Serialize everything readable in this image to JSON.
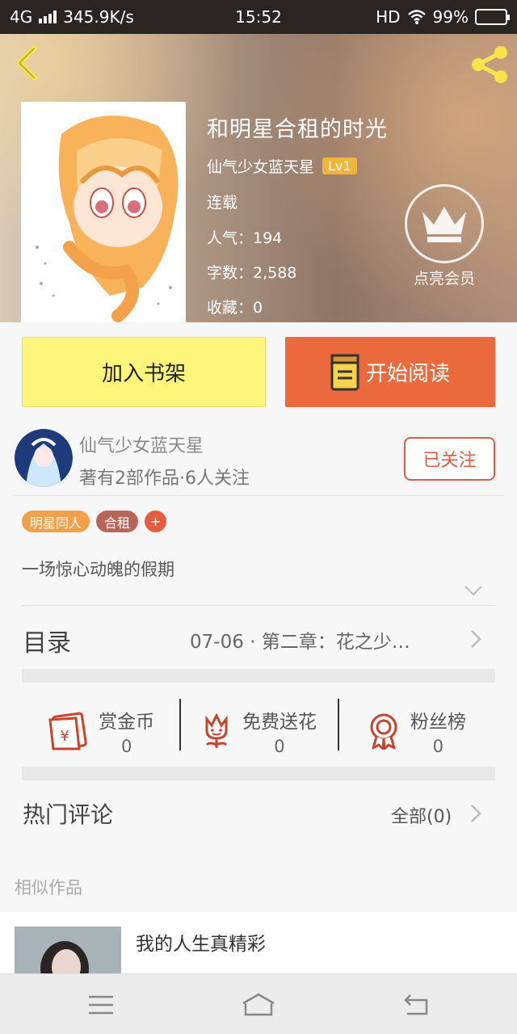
{
  "status_bar": {
    "network": "4G",
    "speed": "345.9K/s",
    "time": "15:52",
    "hd": "HD",
    "battery": "99%"
  },
  "book": {
    "title": "和明星合租的时光",
    "author": "仙气少女蓝天星",
    "level": "Lv1",
    "status": "连载",
    "popularity": "人气：194",
    "word_count": "字数：2,588",
    "favorites": "收藏：0"
  },
  "vip": {
    "label": "点亮会员"
  },
  "actions": {
    "add_shelf": "加入书架",
    "start_reading": "开始阅读"
  },
  "author_info": {
    "name": "仙气少女蓝天星",
    "stats": "著有2部作品·6人关注",
    "follow_label": "已关注"
  },
  "tags": [
    {
      "label": "明星同人",
      "color": "#f3a04a"
    },
    {
      "label": "合租",
      "color": "#b8665a"
    },
    {
      "label": "+",
      "color": "#e85c3d"
    }
  ],
  "summary": "一场惊心动魄的假期",
  "toc": {
    "label": "目录",
    "latest": "07-06 · 第二章：花之少…"
  },
  "support": [
    {
      "label": "赏金币",
      "count": "0",
      "icon": "red-envelope-icon"
    },
    {
      "label": "免费送花",
      "count": "0",
      "icon": "flower-icon"
    },
    {
      "label": "粉丝榜",
      "count": "0",
      "icon": "medal-icon"
    }
  ],
  "comments": {
    "title": "热门评论",
    "all_label": "全部(0)"
  },
  "similar": {
    "title": "相似作品",
    "items": [
      {
        "name": "我的人生真精彩"
      }
    ]
  },
  "colors": {
    "accent_orange": "#ea6a3d",
    "shelf_yellow": "#fef67a",
    "follow_red": "#e05a45",
    "level_gold": "#f2b538"
  }
}
